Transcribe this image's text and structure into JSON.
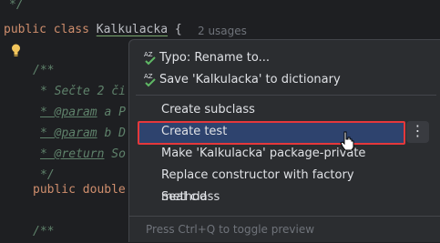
{
  "editor": {
    "lines": {
      "l0": "*/",
      "l1_kw1": "public",
      "l1_kw2": "class",
      "l1_class": "Kalkulacka",
      "l1_brace": "{",
      "l3": "/**",
      "l4_a": "* Sečte 2 či",
      "l5_tag": "* @param",
      "l5_rest": " a P",
      "l6_tag": "* @param",
      "l6_rest": " b D",
      "l7_tag": "* @return",
      "l7_rest": " So",
      "l8": "*/",
      "l9_kw": "public double",
      "l10": "/**"
    },
    "usages": "2 usages"
  },
  "popup": {
    "items": [
      {
        "label": "Typo: Rename to...",
        "icon": "spellcheck-icon"
      },
      {
        "label": "Save 'Kalkulacka' to dictionary",
        "icon": "spellcheck-icon"
      },
      {
        "label": "Create subclass"
      },
      {
        "label": "Create test"
      },
      {
        "label": "Make 'Kalkulacka' package-private"
      },
      {
        "label": "Replace constructor with factory method"
      },
      {
        "label": "Seal class"
      }
    ],
    "more_label": "⋮",
    "footer": "Press Ctrl+Q to toggle preview"
  },
  "colors": {
    "background": "#1e1f22",
    "popup": "#2b2d30",
    "selection": "#2e436e",
    "highlight_border": "#e5383b"
  }
}
